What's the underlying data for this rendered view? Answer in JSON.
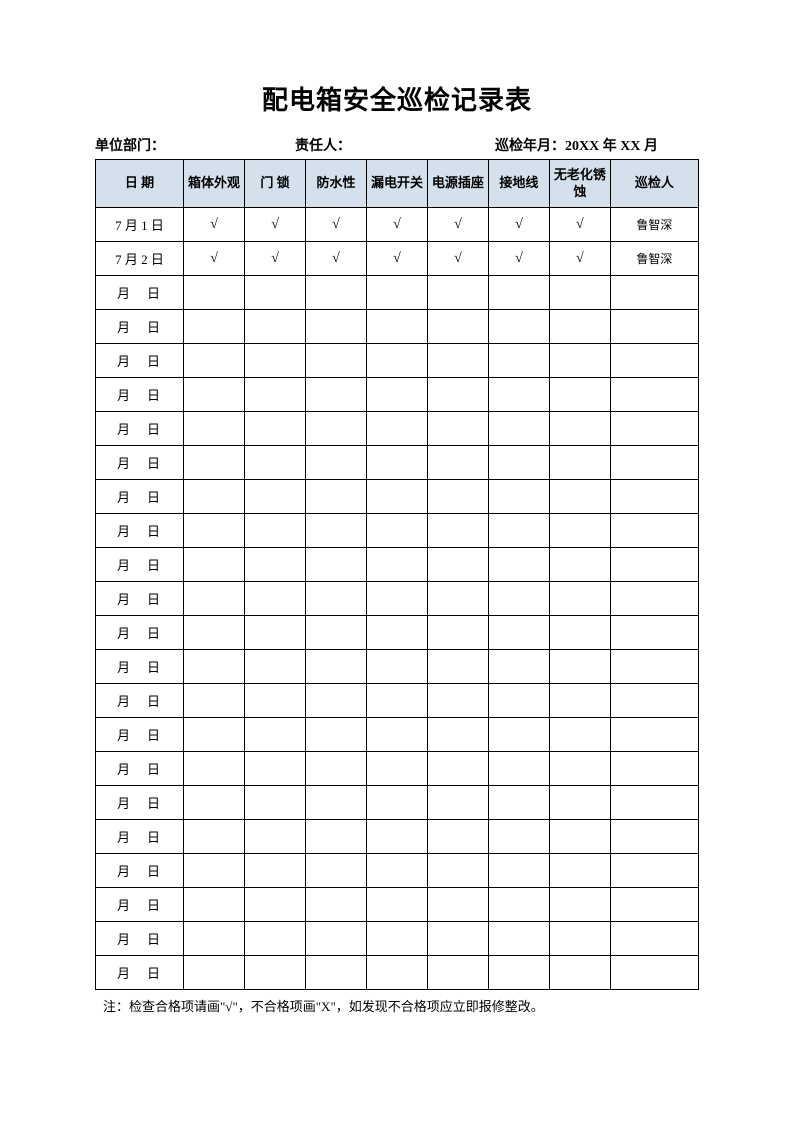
{
  "title": "配电箱安全巡检记录表",
  "meta": {
    "dept_label": "单位部门：",
    "resp_label": "责任人：",
    "period_label": "巡检年月：20XX 年 XX 月"
  },
  "headers": {
    "date": "日 期",
    "col1": "箱体外观",
    "col2": "门 锁",
    "col3": "防水性",
    "col4": "漏电开关",
    "col5": "电源插座",
    "col6": "接地线",
    "col7": "无老化锈蚀",
    "inspector": "巡检人"
  },
  "empty_date": "月　日",
  "rows": [
    {
      "date": "7 月 1 日",
      "c1": "√",
      "c2": "√",
      "c3": "√",
      "c4": "√",
      "c5": "√",
      "c6": "√",
      "c7": "√",
      "inspector": "鲁智深"
    },
    {
      "date": "7 月 2 日",
      "c1": "√",
      "c2": "√",
      "c3": "√",
      "c4": "√",
      "c5": "√",
      "c6": "√",
      "c7": "√",
      "inspector": "鲁智深"
    },
    {
      "date": "",
      "c1": "",
      "c2": "",
      "c3": "",
      "c4": "",
      "c5": "",
      "c6": "",
      "c7": "",
      "inspector": ""
    },
    {
      "date": "",
      "c1": "",
      "c2": "",
      "c3": "",
      "c4": "",
      "c5": "",
      "c6": "",
      "c7": "",
      "inspector": ""
    },
    {
      "date": "",
      "c1": "",
      "c2": "",
      "c3": "",
      "c4": "",
      "c5": "",
      "c6": "",
      "c7": "",
      "inspector": ""
    },
    {
      "date": "",
      "c1": "",
      "c2": "",
      "c3": "",
      "c4": "",
      "c5": "",
      "c6": "",
      "c7": "",
      "inspector": ""
    },
    {
      "date": "",
      "c1": "",
      "c2": "",
      "c3": "",
      "c4": "",
      "c5": "",
      "c6": "",
      "c7": "",
      "inspector": ""
    },
    {
      "date": "",
      "c1": "",
      "c2": "",
      "c3": "",
      "c4": "",
      "c5": "",
      "c6": "",
      "c7": "",
      "inspector": ""
    },
    {
      "date": "",
      "c1": "",
      "c2": "",
      "c3": "",
      "c4": "",
      "c5": "",
      "c6": "",
      "c7": "",
      "inspector": ""
    },
    {
      "date": "",
      "c1": "",
      "c2": "",
      "c3": "",
      "c4": "",
      "c5": "",
      "c6": "",
      "c7": "",
      "inspector": ""
    },
    {
      "date": "",
      "c1": "",
      "c2": "",
      "c3": "",
      "c4": "",
      "c5": "",
      "c6": "",
      "c7": "",
      "inspector": ""
    },
    {
      "date": "",
      "c1": "",
      "c2": "",
      "c3": "",
      "c4": "",
      "c5": "",
      "c6": "",
      "c7": "",
      "inspector": ""
    },
    {
      "date": "",
      "c1": "",
      "c2": "",
      "c3": "",
      "c4": "",
      "c5": "",
      "c6": "",
      "c7": "",
      "inspector": ""
    },
    {
      "date": "",
      "c1": "",
      "c2": "",
      "c3": "",
      "c4": "",
      "c5": "",
      "c6": "",
      "c7": "",
      "inspector": ""
    },
    {
      "date": "",
      "c1": "",
      "c2": "",
      "c3": "",
      "c4": "",
      "c5": "",
      "c6": "",
      "c7": "",
      "inspector": ""
    },
    {
      "date": "",
      "c1": "",
      "c2": "",
      "c3": "",
      "c4": "",
      "c5": "",
      "c6": "",
      "c7": "",
      "inspector": ""
    },
    {
      "date": "",
      "c1": "",
      "c2": "",
      "c3": "",
      "c4": "",
      "c5": "",
      "c6": "",
      "c7": "",
      "inspector": ""
    },
    {
      "date": "",
      "c1": "",
      "c2": "",
      "c3": "",
      "c4": "",
      "c5": "",
      "c6": "",
      "c7": "",
      "inspector": ""
    },
    {
      "date": "",
      "c1": "",
      "c2": "",
      "c3": "",
      "c4": "",
      "c5": "",
      "c6": "",
      "c7": "",
      "inspector": ""
    },
    {
      "date": "",
      "c1": "",
      "c2": "",
      "c3": "",
      "c4": "",
      "c5": "",
      "c6": "",
      "c7": "",
      "inspector": ""
    },
    {
      "date": "",
      "c1": "",
      "c2": "",
      "c3": "",
      "c4": "",
      "c5": "",
      "c6": "",
      "c7": "",
      "inspector": ""
    },
    {
      "date": "",
      "c1": "",
      "c2": "",
      "c3": "",
      "c4": "",
      "c5": "",
      "c6": "",
      "c7": "",
      "inspector": ""
    },
    {
      "date": "",
      "c1": "",
      "c2": "",
      "c3": "",
      "c4": "",
      "c5": "",
      "c6": "",
      "c7": "",
      "inspector": ""
    }
  ],
  "note": "注：检查合格项请画\"√\"，不合格项画\"X\"，如发现不合格项应立即报修整改。"
}
